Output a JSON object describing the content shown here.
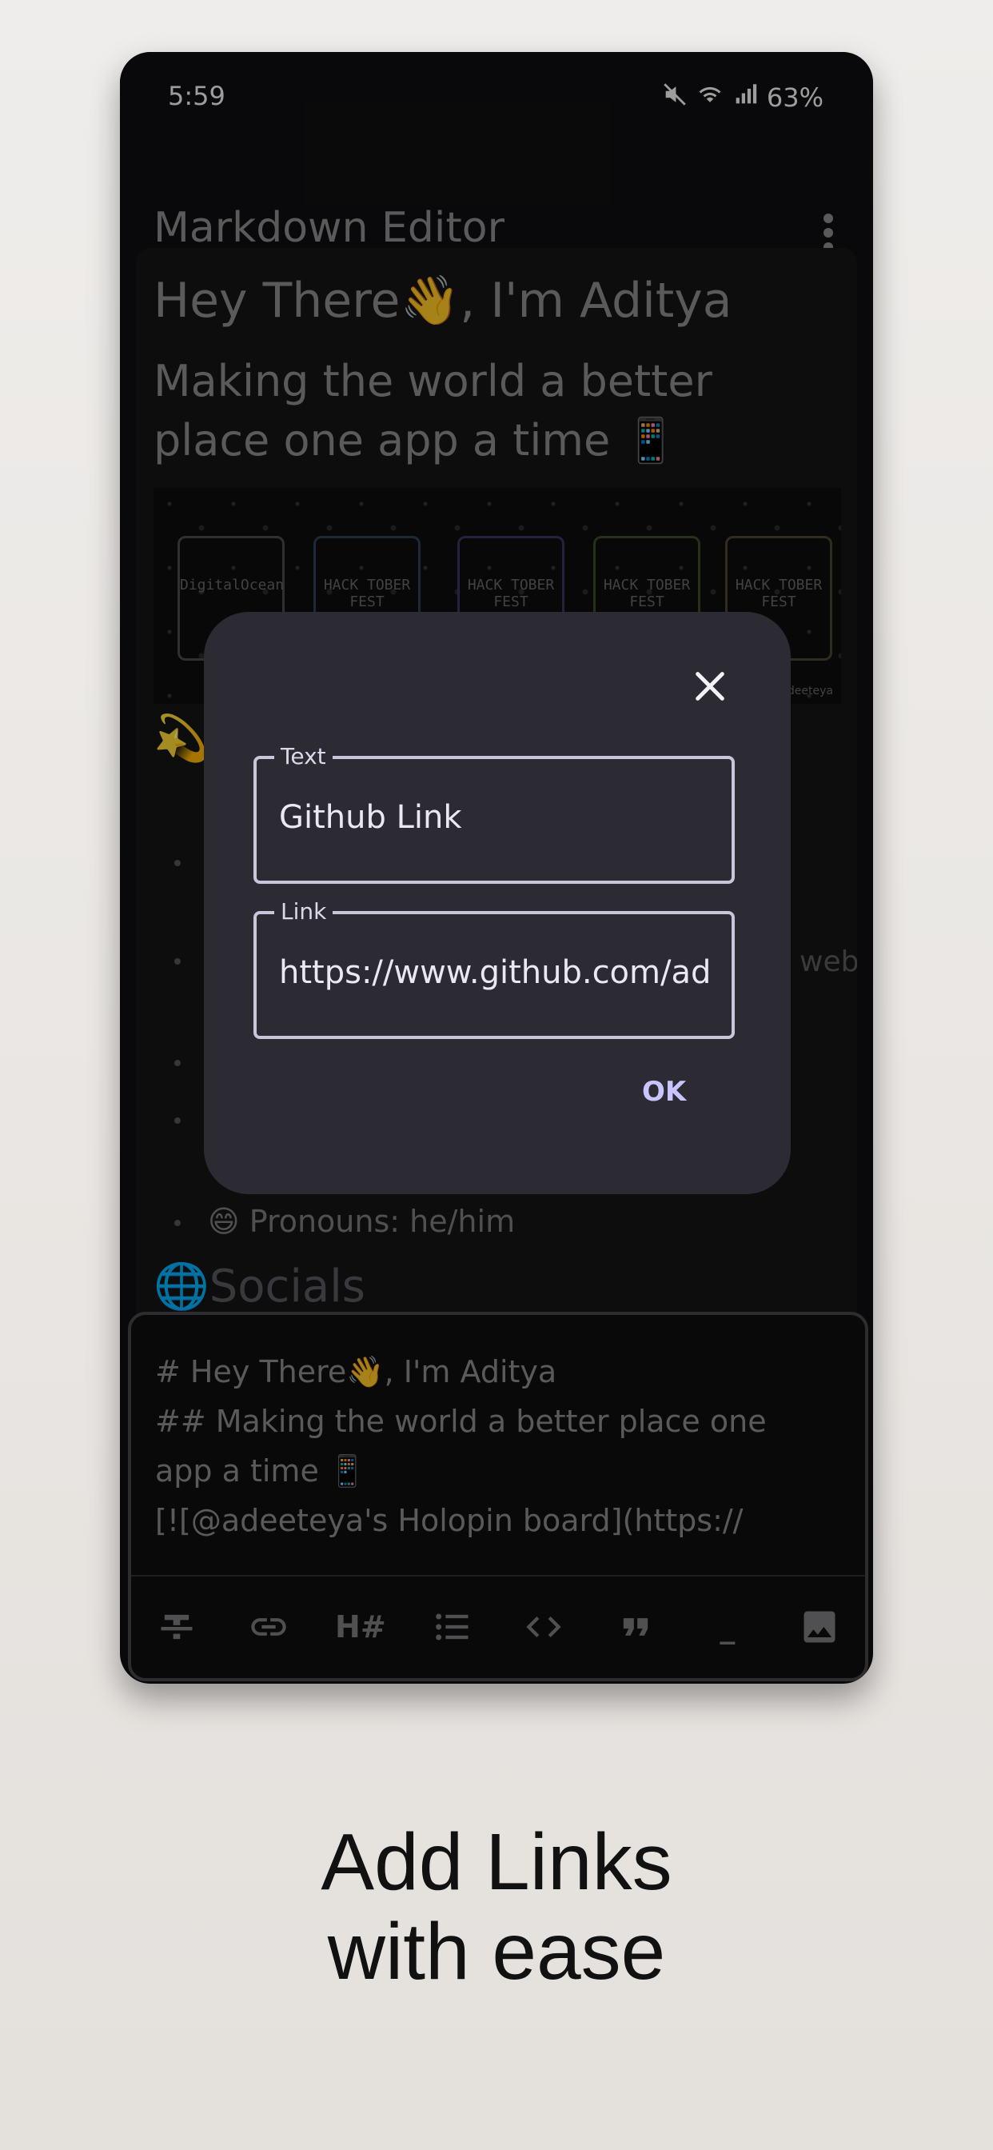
{
  "status_bar": {
    "time": "5:59",
    "battery": "63%"
  },
  "app_bar": {
    "title": "Markdown Editor"
  },
  "preview": {
    "heading1": "Hey There👋, I'm Aditya",
    "heading2": "Making the world a better place one app a time 📱",
    "holopin_badges": [
      "DigitalOcean",
      "HACK TOBER FEST",
      "HACK TOBER FEST",
      "HACK TOBER FEST",
      "HACK TOBER FEST"
    ],
    "holopin_watermark": "adeeteya",
    "partial_web": "web",
    "pronouns": "😄 Pronouns: he/him",
    "socials": "🌐Socials"
  },
  "editor": {
    "line1": "# Hey There👋, I'm Aditya",
    "line2": "## Making the world a better place one",
    "line3": "app a time 📱",
    "line4": "[![@adeeteya's Holopin board](https://"
  },
  "toolbar": {
    "heading_label": "H#",
    "rule_label": "_"
  },
  "dialog": {
    "text_label": "Text",
    "text_value": "Github Link",
    "link_label": "Link",
    "link_value": "https://www.github.com/ad",
    "ok_label": "OK"
  },
  "caption": {
    "line1": "Add Links",
    "line2": "with ease"
  },
  "colors": {
    "accent": "#c7c4ff",
    "dialog_bg": "#2c2b33",
    "field_border": "#c9c6dc"
  }
}
